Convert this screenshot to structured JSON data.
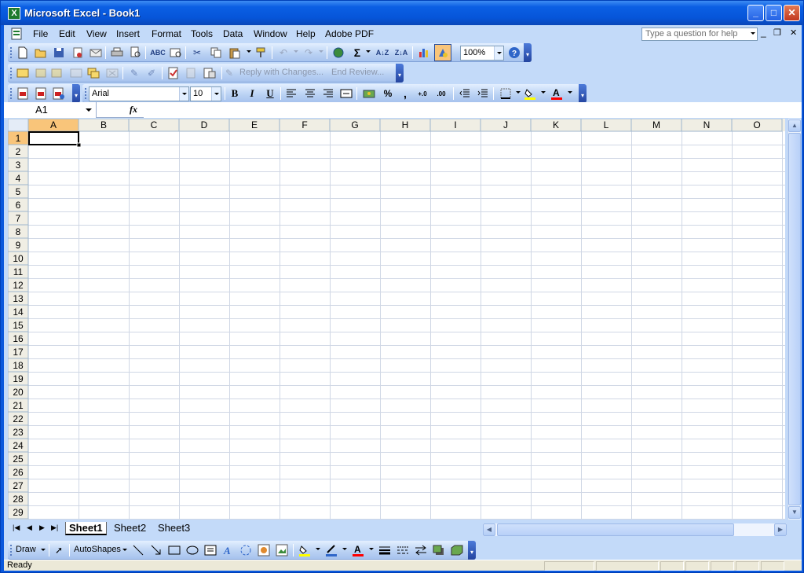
{
  "window": {
    "title": "Microsoft Excel - Book1",
    "app_icon": "excel-icon",
    "controls": [
      "minimize-icon",
      "maximize-icon",
      "close-icon"
    ]
  },
  "menubar": {
    "items": [
      "File",
      "Edit",
      "View",
      "Insert",
      "Format",
      "Tools",
      "Data",
      "Window",
      "Help",
      "Adobe PDF"
    ],
    "help_placeholder": "Type a question for help",
    "doc_controls": [
      "_",
      "❐",
      "✕"
    ]
  },
  "standard_toolbar": {
    "zoom": "100%"
  },
  "reviewing_toolbar": {
    "reply_label": "Reply with Changes...",
    "end_review_label": "End Review..."
  },
  "formatting_toolbar": {
    "font": "Arial",
    "size": "10",
    "bold": "B",
    "italic": "I",
    "underline": "U",
    "percent": "%",
    "comma": ","
  },
  "formula_bar": {
    "name_box": "A1",
    "fx_label": "fx",
    "value": ""
  },
  "grid": {
    "columns": [
      "A",
      "B",
      "C",
      "D",
      "E",
      "F",
      "G",
      "H",
      "I",
      "J",
      "K",
      "L",
      "M",
      "N",
      "O"
    ],
    "rows": [
      "1",
      "2",
      "3",
      "4",
      "5",
      "6",
      "7",
      "8",
      "9",
      "10",
      "11",
      "12",
      "13",
      "14",
      "15",
      "16",
      "17",
      "18",
      "19",
      "20",
      "21",
      "22",
      "23",
      "24",
      "25",
      "26",
      "27",
      "28",
      "29"
    ],
    "active_cell": "A1"
  },
  "sheet_tabs": {
    "tabs": [
      "Sheet1",
      "Sheet2",
      "Sheet3"
    ],
    "active": "Sheet1"
  },
  "drawing_toolbar": {
    "draw_label": "Draw",
    "autoshapes_label": "AutoShapes"
  },
  "status": {
    "text": "Ready"
  },
  "colors": {
    "titlebar": "#0a5ae0",
    "toolbar_bg": "#c3daf9",
    "grid_line": "#d0d7e5",
    "header_bg": "#f0eee4",
    "active_header": "#f9c57a",
    "fill_color": "#ffff00",
    "font_color": "#ff0000"
  }
}
